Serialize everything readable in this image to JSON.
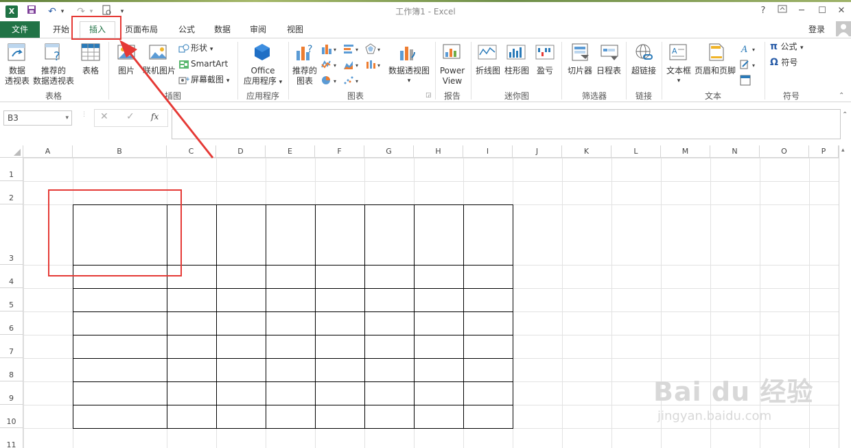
{
  "window": {
    "title": "工作簿1 - Excel",
    "app_icon": "X",
    "help": "?",
    "login": "登录"
  },
  "tabs": [
    {
      "label": "文件"
    },
    {
      "label": "开始"
    },
    {
      "label": "插入"
    },
    {
      "label": "页面布局"
    },
    {
      "label": "公式"
    },
    {
      "label": "数据"
    },
    {
      "label": "审阅"
    },
    {
      "label": "视图"
    }
  ],
  "ribbon": {
    "tables": {
      "group": "表格",
      "pivot": [
        "数据",
        "透视表"
      ],
      "recommended_pivot": [
        "推荐的",
        "数据透视表"
      ],
      "table": "表格"
    },
    "illustrations": {
      "group": "插图",
      "picture": "图片",
      "online_picture": "联机图片",
      "shapes": "形状",
      "smartart": "SmartArt",
      "screenshot": "屏幕截图"
    },
    "apps": {
      "group": "应用程序",
      "office": [
        "Office",
        "应用程序"
      ]
    },
    "charts": {
      "group": "图表",
      "recommended": [
        "推荐的",
        "图表"
      ],
      "pivot_chart": "数据透视图"
    },
    "reports": {
      "group": "报告",
      "power_view": [
        "Power",
        "View"
      ]
    },
    "sparklines": {
      "group": "迷你图",
      "line": "折线图",
      "column": "柱形图",
      "winloss": "盈亏"
    },
    "filters": {
      "group": "筛选器",
      "slicer": "切片器",
      "timeline": "日程表"
    },
    "links": {
      "group": "链接",
      "hyperlink": "超链接"
    },
    "text": {
      "group": "文本",
      "textbox": "文本框",
      "header_footer": "页眉和页脚"
    },
    "symbols": {
      "group": "符号",
      "equation": "公式",
      "symbol": "符号"
    }
  },
  "formula_bar": {
    "name_box": "B3",
    "cancel": "✕",
    "enter": "✓",
    "fx": "fx",
    "value": ""
  },
  "columns": [
    "A",
    "B",
    "C",
    "D",
    "E",
    "F",
    "G",
    "H",
    "I",
    "J",
    "K",
    "L",
    "M",
    "N",
    "O",
    "P"
  ],
  "rows": [
    "1",
    "2",
    "3",
    "4",
    "5",
    "6",
    "7",
    "8",
    "9",
    "10",
    "11"
  ],
  "watermark": {
    "brand": "Bai du 经验",
    "url": "jingyan.baidu.com"
  },
  "colors": {
    "excel_green": "#217346",
    "annotation_red": "#e53935"
  }
}
